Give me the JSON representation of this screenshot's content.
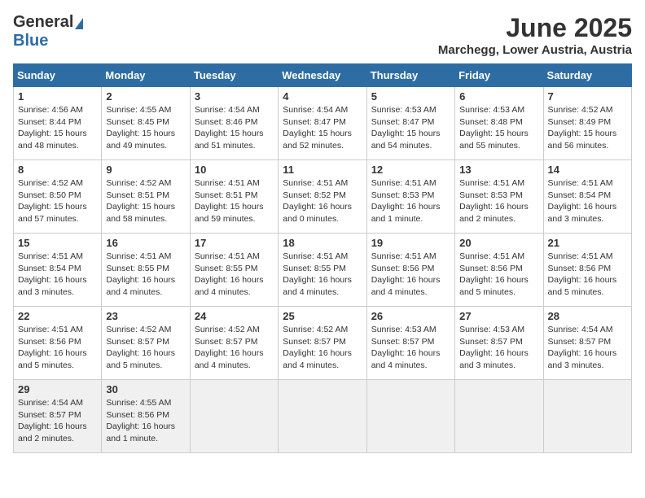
{
  "logo": {
    "general": "General",
    "blue": "Blue"
  },
  "title": {
    "month": "June 2025",
    "location": "Marchegg, Lower Austria, Austria"
  },
  "headers": [
    "Sunday",
    "Monday",
    "Tuesday",
    "Wednesday",
    "Thursday",
    "Friday",
    "Saturday"
  ],
  "weeks": [
    [
      {
        "day": "1",
        "info": "Sunrise: 4:56 AM\nSunset: 8:44 PM\nDaylight: 15 hours\nand 48 minutes."
      },
      {
        "day": "2",
        "info": "Sunrise: 4:55 AM\nSunset: 8:45 PM\nDaylight: 15 hours\nand 49 minutes."
      },
      {
        "day": "3",
        "info": "Sunrise: 4:54 AM\nSunset: 8:46 PM\nDaylight: 15 hours\nand 51 minutes."
      },
      {
        "day": "4",
        "info": "Sunrise: 4:54 AM\nSunset: 8:47 PM\nDaylight: 15 hours\nand 52 minutes."
      },
      {
        "day": "5",
        "info": "Sunrise: 4:53 AM\nSunset: 8:47 PM\nDaylight: 15 hours\nand 54 minutes."
      },
      {
        "day": "6",
        "info": "Sunrise: 4:53 AM\nSunset: 8:48 PM\nDaylight: 15 hours\nand 55 minutes."
      },
      {
        "day": "7",
        "info": "Sunrise: 4:52 AM\nSunset: 8:49 PM\nDaylight: 15 hours\nand 56 minutes."
      }
    ],
    [
      {
        "day": "8",
        "info": "Sunrise: 4:52 AM\nSunset: 8:50 PM\nDaylight: 15 hours\nand 57 minutes."
      },
      {
        "day": "9",
        "info": "Sunrise: 4:52 AM\nSunset: 8:51 PM\nDaylight: 15 hours\nand 58 minutes."
      },
      {
        "day": "10",
        "info": "Sunrise: 4:51 AM\nSunset: 8:51 PM\nDaylight: 15 hours\nand 59 minutes."
      },
      {
        "day": "11",
        "info": "Sunrise: 4:51 AM\nSunset: 8:52 PM\nDaylight: 16 hours\nand 0 minutes."
      },
      {
        "day": "12",
        "info": "Sunrise: 4:51 AM\nSunset: 8:53 PM\nDaylight: 16 hours\nand 1 minute."
      },
      {
        "day": "13",
        "info": "Sunrise: 4:51 AM\nSunset: 8:53 PM\nDaylight: 16 hours\nand 2 minutes."
      },
      {
        "day": "14",
        "info": "Sunrise: 4:51 AM\nSunset: 8:54 PM\nDaylight: 16 hours\nand 3 minutes."
      }
    ],
    [
      {
        "day": "15",
        "info": "Sunrise: 4:51 AM\nSunset: 8:54 PM\nDaylight: 16 hours\nand 3 minutes."
      },
      {
        "day": "16",
        "info": "Sunrise: 4:51 AM\nSunset: 8:55 PM\nDaylight: 16 hours\nand 4 minutes."
      },
      {
        "day": "17",
        "info": "Sunrise: 4:51 AM\nSunset: 8:55 PM\nDaylight: 16 hours\nand 4 minutes."
      },
      {
        "day": "18",
        "info": "Sunrise: 4:51 AM\nSunset: 8:55 PM\nDaylight: 16 hours\nand 4 minutes."
      },
      {
        "day": "19",
        "info": "Sunrise: 4:51 AM\nSunset: 8:56 PM\nDaylight: 16 hours\nand 4 minutes."
      },
      {
        "day": "20",
        "info": "Sunrise: 4:51 AM\nSunset: 8:56 PM\nDaylight: 16 hours\nand 5 minutes."
      },
      {
        "day": "21",
        "info": "Sunrise: 4:51 AM\nSunset: 8:56 PM\nDaylight: 16 hours\nand 5 minutes."
      }
    ],
    [
      {
        "day": "22",
        "info": "Sunrise: 4:51 AM\nSunset: 8:56 PM\nDaylight: 16 hours\nand 5 minutes."
      },
      {
        "day": "23",
        "info": "Sunrise: 4:52 AM\nSunset: 8:57 PM\nDaylight: 16 hours\nand 5 minutes."
      },
      {
        "day": "24",
        "info": "Sunrise: 4:52 AM\nSunset: 8:57 PM\nDaylight: 16 hours\nand 4 minutes."
      },
      {
        "day": "25",
        "info": "Sunrise: 4:52 AM\nSunset: 8:57 PM\nDaylight: 16 hours\nand 4 minutes."
      },
      {
        "day": "26",
        "info": "Sunrise: 4:53 AM\nSunset: 8:57 PM\nDaylight: 16 hours\nand 4 minutes."
      },
      {
        "day": "27",
        "info": "Sunrise: 4:53 AM\nSunset: 8:57 PM\nDaylight: 16 hours\nand 3 minutes."
      },
      {
        "day": "28",
        "info": "Sunrise: 4:54 AM\nSunset: 8:57 PM\nDaylight: 16 hours\nand 3 minutes."
      }
    ],
    [
      {
        "day": "29",
        "info": "Sunrise: 4:54 AM\nSunset: 8:57 PM\nDaylight: 16 hours\nand 2 minutes."
      },
      {
        "day": "30",
        "info": "Sunrise: 4:55 AM\nSunset: 8:56 PM\nDaylight: 16 hours\nand 1 minute."
      },
      {
        "day": "",
        "info": ""
      },
      {
        "day": "",
        "info": ""
      },
      {
        "day": "",
        "info": ""
      },
      {
        "day": "",
        "info": ""
      },
      {
        "day": "",
        "info": ""
      }
    ]
  ]
}
